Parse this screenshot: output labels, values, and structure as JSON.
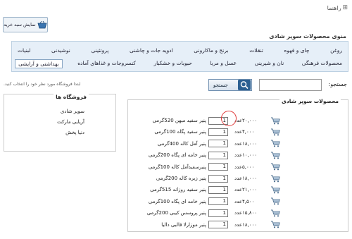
{
  "help": {
    "label": "راهنما"
  },
  "cart_button": {
    "label": "نمایش سبد خرید"
  },
  "menu": {
    "title": "منوی محصولات سوپر شادی",
    "row1": [
      "لبنیات",
      "نوشیدنی",
      "پروتئینی",
      "ادویه جات و چاشنی",
      "برنج و ماکارونی",
      "تنقلات",
      "چای و قهوه",
      "روغن"
    ],
    "row2": [
      "بهداشتی و آرایشی",
      "کنسروجات و غذاهای آماده",
      "حبوبات و خشکبار",
      "عسل و مربا",
      "نان و شیرینی",
      "محصولات فرهنگی"
    ],
    "active": "بهداشتی و آرایشی"
  },
  "search": {
    "label": "جستجو:",
    "value": "",
    "button_label": "جستجو"
  },
  "hint": "ابتدا فروشگاه مورد نظر خود را انتخاب کنید.",
  "stores": {
    "title": "فروشگاه ها",
    "items": [
      "سوپر شادی",
      "آریایی مارکت",
      "دنیا پخش"
    ]
  },
  "products": {
    "title": "محصولات سوپر شادی",
    "unit": "عدد",
    "items": [
      {
        "name": "پنیر سفید میهن 520گرمی",
        "qty": "1",
        "price": "۲۰,۰۰۰"
      },
      {
        "name": "پنیر سفید پگاه 100گرمی",
        "qty": "1",
        "price": "۴,۰۰۰"
      },
      {
        "name": "پنیر آمل کاله 400گرمی",
        "qty": "1",
        "price": "۱۸,۰۰۰"
      },
      {
        "name": "پنیر خامه ای پگاه 200گرمی",
        "qty": "1",
        "price": "۱۰,۰۰۰"
      },
      {
        "name": "پنیرسفیدآمل کاله 100گرمی",
        "qty": "1",
        "price": "۵,۰۰۰"
      },
      {
        "name": "پنیر زیره کاله 200گرمی",
        "qty": "1",
        "price": "۱۸,۰۰۰"
      },
      {
        "name": "پنیر سفید روزانه 515گرمی",
        "qty": "1",
        "price": "۲۱,۰۰۰"
      },
      {
        "name": "پنیر خامه ای پگاه 100گرمی",
        "qty": "1",
        "price": "۴,۵۰۰"
      },
      {
        "name": "پنیر پروسس کیبی 200گرمی",
        "qty": "1",
        "price": "۱۵,۸۰۰"
      },
      {
        "name": "پنیر موزارلا قالبی دالیا",
        "qty": "1",
        "price": "۱۸,۰۰۰"
      }
    ]
  },
  "colors": {
    "accent": "#2b5f91",
    "highlight_circle": "#e03a3a",
    "menu_bg": "#e6eff8"
  }
}
